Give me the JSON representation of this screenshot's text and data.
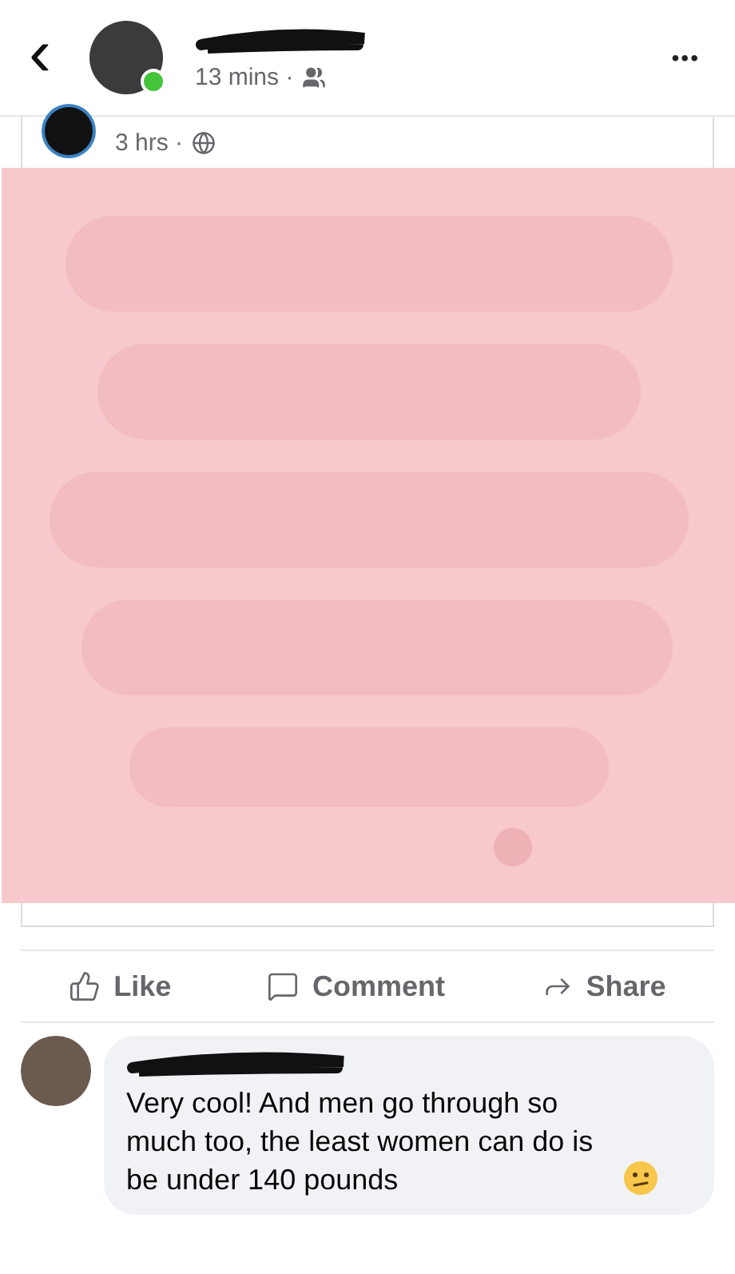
{
  "header": {
    "back": "‹",
    "time": "13 mins ·",
    "online": true,
    "more": "•••"
  },
  "shared_post": {
    "time": "3 hrs ·"
  },
  "actions": [
    {
      "label": "Like",
      "kind": "like"
    },
    {
      "label": "Comment",
      "kind": "comment"
    },
    {
      "label": "Share",
      "kind": "share"
    }
  ],
  "comment": {
    "text": "Very cool! And men go through so much too, the least women can do is be under 140 pounds"
  }
}
